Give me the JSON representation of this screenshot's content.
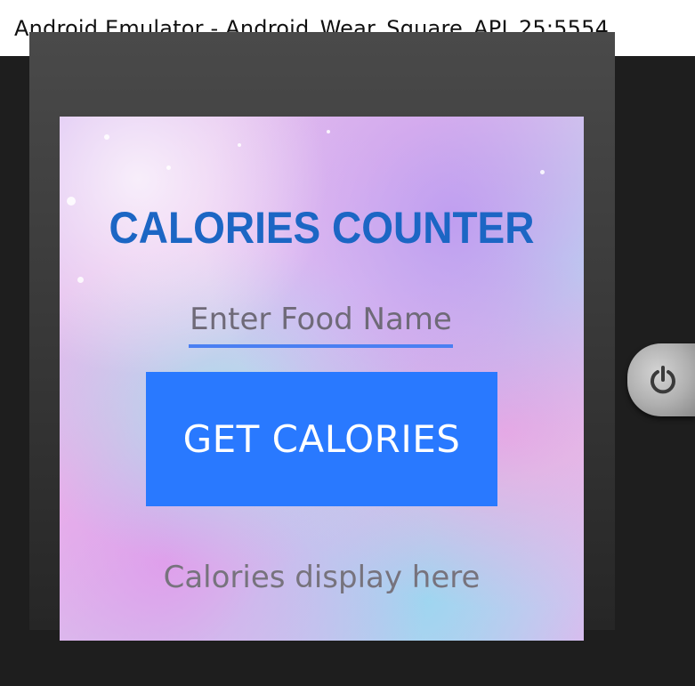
{
  "window": {
    "title": "Android Emulator - Android_Wear_Square_API_25:5554"
  },
  "app": {
    "title": "CALORIES COUNTER",
    "food_input": {
      "value": "",
      "placeholder": "Enter Food Name"
    },
    "get_button_label": "GET CALORIES",
    "result_text": "Calories display here"
  },
  "emulator": {
    "power_icon": "power-icon"
  },
  "colors": {
    "title": "#1c66c4",
    "button": "#2979ff",
    "input_underline": "#4a7ff2",
    "result_text": "#77737d"
  }
}
